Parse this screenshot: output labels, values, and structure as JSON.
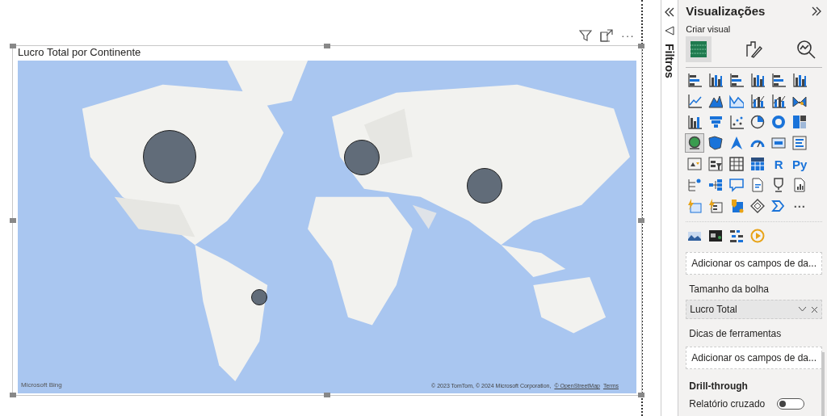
{
  "canvas": {
    "header_more": "···",
    "visual": {
      "title": "Lucro Total por Continente",
      "map": {
        "kind": "picture",
        "logo_text": "Microsoft Bing",
        "attribution": "© 2023 TomTom, © 2024 Microsoft Corporation,",
        "attribution_link": "© OpenStreetMap",
        "terms_link": "Terms"
      }
    }
  },
  "filters_pane": {
    "label": "Filtros"
  },
  "visualizations": {
    "title": "Visualizações",
    "subtitle": "Criar visual",
    "tabs": [
      {
        "selected": true
      },
      {
        "selected": false
      },
      {
        "selected": false
      }
    ],
    "gallery": [
      {
        "kind": "icon",
        "selected": false
      },
      {
        "kind": "icon",
        "selected": false
      },
      {
        "kind": "icon",
        "selected": false
      },
      {
        "kind": "icon",
        "selected": false
      },
      {
        "kind": "icon",
        "selected": false
      },
      {
        "kind": "icon",
        "selected": false
      },
      {
        "kind": "icon",
        "selected": false
      },
      {
        "kind": "icon",
        "selected": false
      },
      {
        "kind": "icon",
        "selected": false
      },
      {
        "kind": "icon",
        "selected": false
      },
      {
        "kind": "icon",
        "selected": false
      },
      {
        "kind": "icon",
        "selected": false
      },
      {
        "kind": "icon",
        "selected": false
      },
      {
        "kind": "icon",
        "selected": false
      },
      {
        "kind": "icon",
        "selected": false
      },
      {
        "kind": "icon",
        "selected": false
      },
      {
        "kind": "icon",
        "selected": false
      },
      {
        "kind": "icon",
        "selected": false
      },
      {
        "kind": "icon",
        "selected": true
      },
      {
        "kind": "icon",
        "selected": false
      },
      {
        "kind": "icon",
        "selected": false
      },
      {
        "kind": "icon",
        "selected": false
      },
      {
        "kind": "icon",
        "selected": false
      },
      {
        "kind": "icon",
        "selected": false
      },
      {
        "kind": "icon",
        "selected": false
      },
      {
        "kind": "icon",
        "selected": false
      },
      {
        "kind": "icon",
        "selected": false
      },
      {
        "kind": "icon",
        "selected": false
      },
      {
        "kind": "text",
        "label": "R",
        "selected": false
      },
      {
        "kind": "text",
        "label": "Py",
        "selected": false
      },
      {
        "kind": "icon",
        "selected": false
      },
      {
        "kind": "icon",
        "selected": false
      },
      {
        "kind": "icon",
        "selected": false
      },
      {
        "kind": "icon",
        "selected": false
      },
      {
        "kind": "icon",
        "selected": false
      },
      {
        "kind": "icon",
        "selected": false
      },
      {
        "kind": "icon",
        "selected": false
      },
      {
        "kind": "icon",
        "selected": false
      },
      {
        "kind": "icon",
        "selected": false
      },
      {
        "kind": "icon",
        "selected": false
      },
      {
        "kind": "icon",
        "selected": false
      },
      {
        "kind": "text",
        "label": "···",
        "selected": false
      }
    ],
    "custom": [
      {
        "kind": "icon",
        "selected": false
      },
      {
        "kind": "icon",
        "selected": false
      },
      {
        "kind": "icon",
        "selected": false
      },
      {
        "kind": "icon",
        "selected": false
      }
    ],
    "wells": [
      {
        "kind": "drop_zone",
        "text": "Adicionar os campos de da..."
      },
      {
        "kind": "label",
        "text": "Tamanho da bolha"
      },
      {
        "kind": "field",
        "text": "Lucro Total"
      },
      {
        "kind": "label",
        "text": "Dicas de ferramentas"
      },
      {
        "kind": "drop_zone",
        "text": "Adicionar os campos de da..."
      },
      {
        "kind": "heading",
        "text": "Drill-through"
      },
      {
        "kind": "toggle",
        "text": "Relatório cruzado",
        "on": false
      }
    ]
  }
}
